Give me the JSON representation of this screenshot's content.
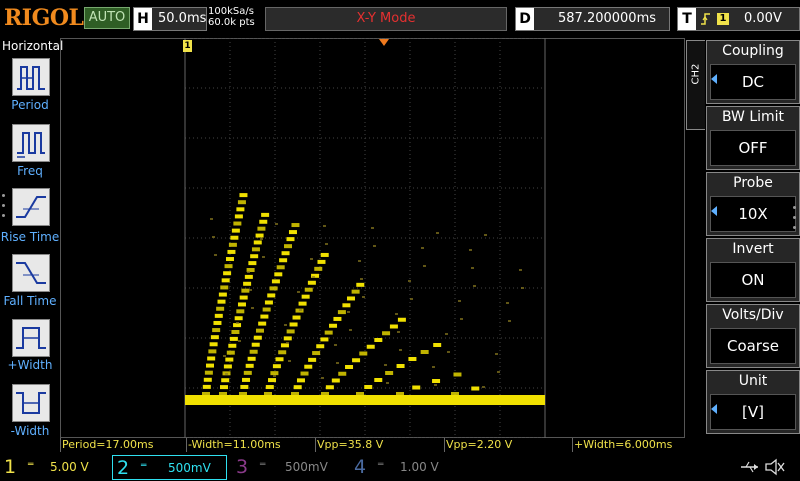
{
  "brand": "RIGOL",
  "top": {
    "auto_label": "AUTO",
    "horiz_letter": "H",
    "timebase": "50.0ms",
    "sample_rate": "100kSa/s",
    "memory_depth": "60.0k pts",
    "mode": "X-Y Mode",
    "delay_letter": "D",
    "delay_value": "587.200000ms",
    "trig_letter": "T",
    "trig_source": "1",
    "trig_level": "0.00V",
    "colors": {
      "brand": "#f08a1e",
      "mode": "#e53030",
      "trig_source": "#f0e24a"
    }
  },
  "left_panel": {
    "title": "Horizontal",
    "items": [
      {
        "label": "Period",
        "icon": "period-icon"
      },
      {
        "label": "Freq",
        "icon": "freq-icon"
      },
      {
        "label": "Rise Time",
        "icon": "rise-time-icon"
      },
      {
        "label": "Fall Time",
        "icon": "fall-time-icon"
      },
      {
        "label": "+Width",
        "icon": "positive-width-icon"
      },
      {
        "label": "-Width",
        "icon": "negative-width-icon"
      }
    ]
  },
  "markers": {
    "trigger_marker": "1"
  },
  "measurements": [
    "Period=17.00ms",
    "-Width=11.00ms",
    "Vpp=35.8 V",
    "Vpp=2.20 V",
    "+Width=6.000ms"
  ],
  "channel_menu": {
    "tab": "CH2",
    "items": [
      {
        "title": "Coupling",
        "value": "DC"
      },
      {
        "title": "BW Limit",
        "value": "OFF"
      },
      {
        "title": "Probe",
        "value": "10X"
      },
      {
        "title": "Invert",
        "value": "ON"
      },
      {
        "title": "Volts/Div",
        "value": "Coarse"
      },
      {
        "title": "Unit",
        "value": "[V]"
      }
    ]
  },
  "channels": [
    {
      "num": "1",
      "scale": "5.00 V",
      "color": "#f0e24a",
      "active": false
    },
    {
      "num": "2",
      "scale": "500mV",
      "color": "#2fe0f0",
      "active": true
    },
    {
      "num": "3",
      "scale": "500mV",
      "color": "#8a3a8a",
      "active": false
    },
    {
      "num": "4",
      "scale": "1.00 V",
      "color": "#4a6aa0",
      "active": false
    }
  ],
  "trace_color": "#f0e000"
}
